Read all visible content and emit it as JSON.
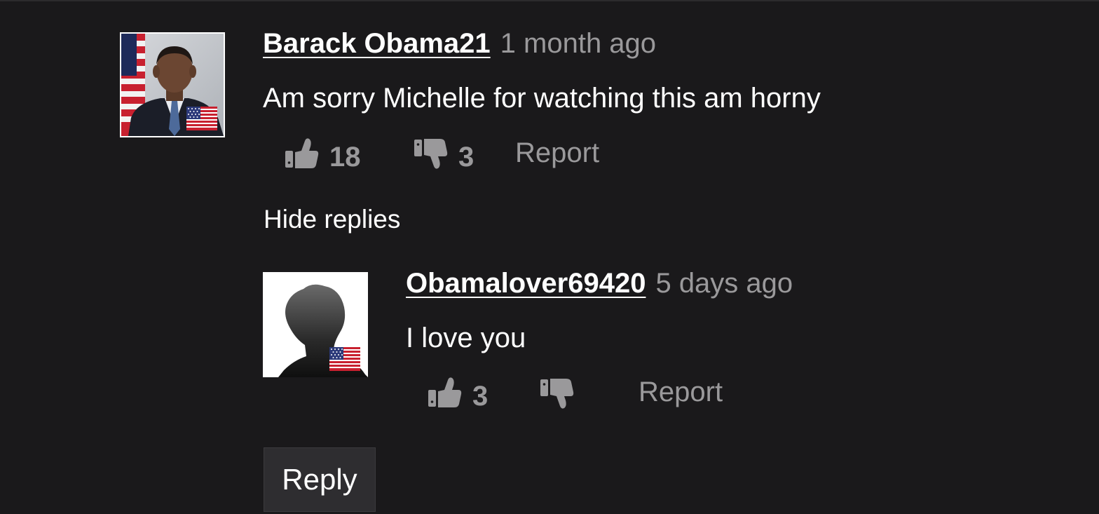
{
  "theme": {
    "background": "#1a191b",
    "text_primary": "#ffffff",
    "text_secondary": "#9a999b",
    "button_bg": "#2e2d30"
  },
  "comment": {
    "username": "Barack Obama21",
    "timestamp": "1 month ago",
    "text": "Am sorry Michelle for watching this am horny",
    "likes": "18",
    "dislikes": "3",
    "report_label": "Report",
    "avatar_icon": "user-photo-avatar",
    "avatar_flag": "us-flag-icon"
  },
  "hide_replies_label": "Hide replies",
  "reply": {
    "username": "Obamalover69420",
    "timestamp": "5 days ago",
    "text": "I love you",
    "likes": "3",
    "report_label": "Report",
    "avatar_icon": "default-silhouette-avatar",
    "avatar_flag": "us-flag-icon"
  },
  "reply_button_label": "Reply"
}
